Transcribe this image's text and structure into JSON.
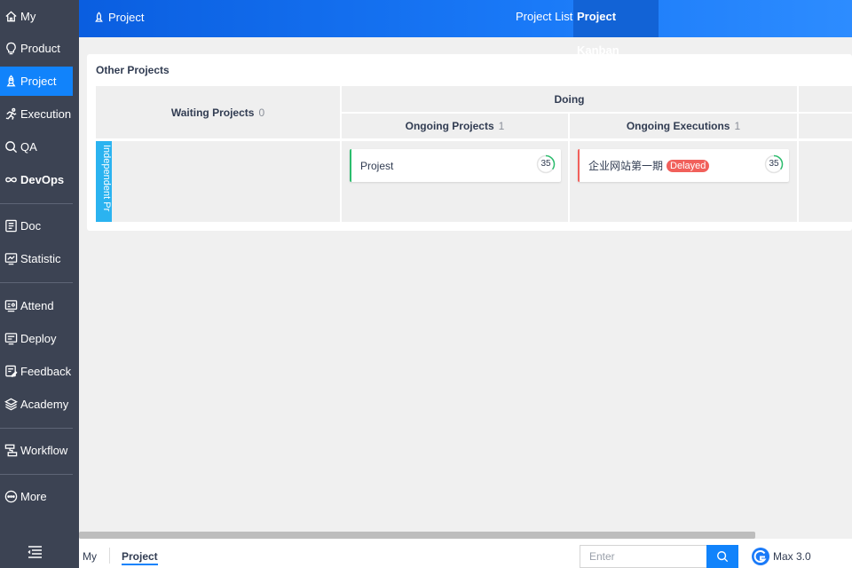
{
  "sidebar": {
    "items": [
      {
        "label": "My",
        "icon": "home-icon"
      },
      {
        "label": "Product",
        "icon": "lightbulb-icon"
      },
      {
        "label": "Project",
        "icon": "project-icon",
        "active": true
      },
      {
        "label": "Execution",
        "icon": "run-icon"
      },
      {
        "label": "QA",
        "icon": "qa-icon"
      },
      {
        "label": "DevOps",
        "icon": "infinity-icon"
      },
      {
        "label": "Doc",
        "icon": "doc-icon"
      },
      {
        "label": "Statistic",
        "icon": "chart-icon"
      },
      {
        "label": "Attend",
        "icon": "attend-icon"
      },
      {
        "label": "Deploy",
        "icon": "deploy-icon"
      },
      {
        "label": "Feedback",
        "icon": "feedback-icon"
      },
      {
        "label": "Academy",
        "icon": "academy-icon"
      },
      {
        "label": "Workflow",
        "icon": "workflow-icon"
      },
      {
        "label": "More",
        "icon": "more-icon"
      }
    ],
    "toggle_icon": "menu-toggle-icon"
  },
  "header": {
    "title": "Project",
    "tabs": [
      {
        "label": "Project List"
      },
      {
        "label": "Project Kanban",
        "active": true
      }
    ]
  },
  "panel": {
    "title": "Other Projects",
    "columns": {
      "waiting": {
        "label": "Waiting Projects",
        "count": "0"
      },
      "doing": {
        "label": "Doing"
      },
      "ongoing_projects": {
        "label": "Ongoing Projects",
        "count": "1"
      },
      "ongoing_executions": {
        "label": "Ongoing Executions",
        "count": "1"
      }
    },
    "lane_label": "Independent Pr",
    "cards": [
      {
        "name": "Projest",
        "progress": "35",
        "status_color": "#2bbd6d"
      },
      {
        "name": "企业网站第一期",
        "badge": "Delayed",
        "progress": "35",
        "status_color": "#f1605b"
      }
    ]
  },
  "footer": {
    "breadcrumbs": [
      {
        "label": "My"
      },
      {
        "label": "Project",
        "active": true
      }
    ],
    "search": {
      "placeholder": "Enter"
    },
    "version": "Max 3.0"
  },
  "colors": {
    "sidebar_bg": "#3c4353",
    "accent": "#1183fb",
    "delayed": "#f1605b",
    "ongoing": "#2bbd6d",
    "lane": "#2bb3f0"
  }
}
